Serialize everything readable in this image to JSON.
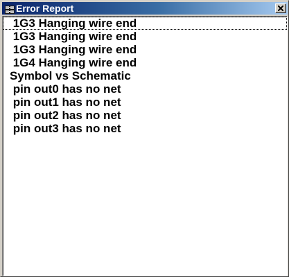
{
  "window": {
    "title": "Error Report",
    "icon": "error-report-app-icon",
    "close_icon": "close-icon"
  },
  "errors": [
    {
      "text": " 1G3 Hanging wire end",
      "focused": true
    },
    {
      "text": " 1G3 Hanging wire end",
      "focused": false
    },
    {
      "text": " 1G3 Hanging wire end",
      "focused": false
    },
    {
      "text": " 1G4 Hanging wire end",
      "focused": false
    },
    {
      "text": "Symbol vs Schematic",
      "focused": false
    },
    {
      "text": " pin out0 has no net",
      "focused": false
    },
    {
      "text": " pin out1 has no net",
      "focused": false
    },
    {
      "text": " pin out2 has no net",
      "focused": false
    },
    {
      "text": " pin out3 has no net",
      "focused": false
    }
  ],
  "colors": {
    "titlebar_start": "#0a246a",
    "titlebar_end": "#a6caf0",
    "list_background": "#ffffff",
    "window_face": "#d4d0c8"
  }
}
